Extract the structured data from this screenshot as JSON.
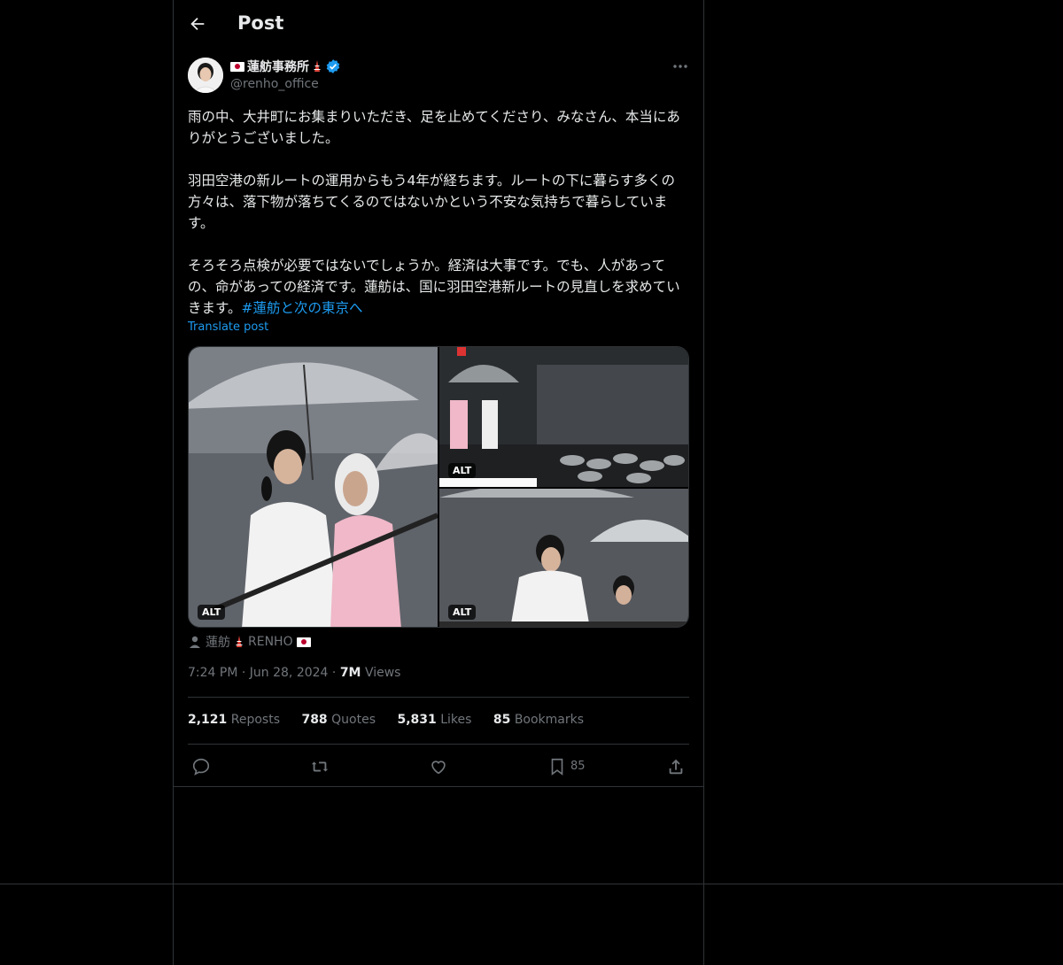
{
  "header": {
    "title": "Post"
  },
  "author": {
    "display_name": "蓮舫事務所",
    "handle": "@renho_office",
    "verified": true
  },
  "post": {
    "paragraphs": [
      "雨の中、大井町にお集まりいただき、足を止めてくださり、みなさん、本当にありがとうございました。",
      "羽田空港の新ルートの運用からもう4年が経ちます。ルートの下に暮らす多くの方々は、落下物が落ちてくるのではないかという不安な気持ちで暮らしています。",
      "そろそろ点検が必要ではないでしょうか。経済は大事です。でも、人があっての、命があっての経済です。蓮舫は、国に羽田空港新ルートの見直しを求めていきます。"
    ],
    "hashtag": "#蓮舫と次の東京へ",
    "translate_label": "Translate post",
    "media_alt_label": "ALT",
    "tagged_user": "蓮舫",
    "tagged_user_suffix": "RENHO",
    "time": "7:24 PM",
    "date": "Jun 28, 2024",
    "views_count": "7M",
    "views_label": "Views"
  },
  "stats": {
    "reposts_count": "2,121",
    "reposts_label": "Reposts",
    "quotes_count": "788",
    "quotes_label": "Quotes",
    "likes_count": "5,831",
    "likes_label": "Likes",
    "bookmarks_count": "85",
    "bookmarks_label": "Bookmarks"
  },
  "actions": {
    "bookmark_count": "85"
  },
  "colors": {
    "background": "#000000",
    "text": "#e7e9ea",
    "muted": "#71767b",
    "accent": "#1d9bf0",
    "border": "#2f3336"
  },
  "icons": [
    "back-arrow-icon",
    "verified-badge-icon",
    "more-icon",
    "reply-icon",
    "repost-icon",
    "like-icon",
    "bookmark-icon",
    "share-icon",
    "person-icon"
  ]
}
